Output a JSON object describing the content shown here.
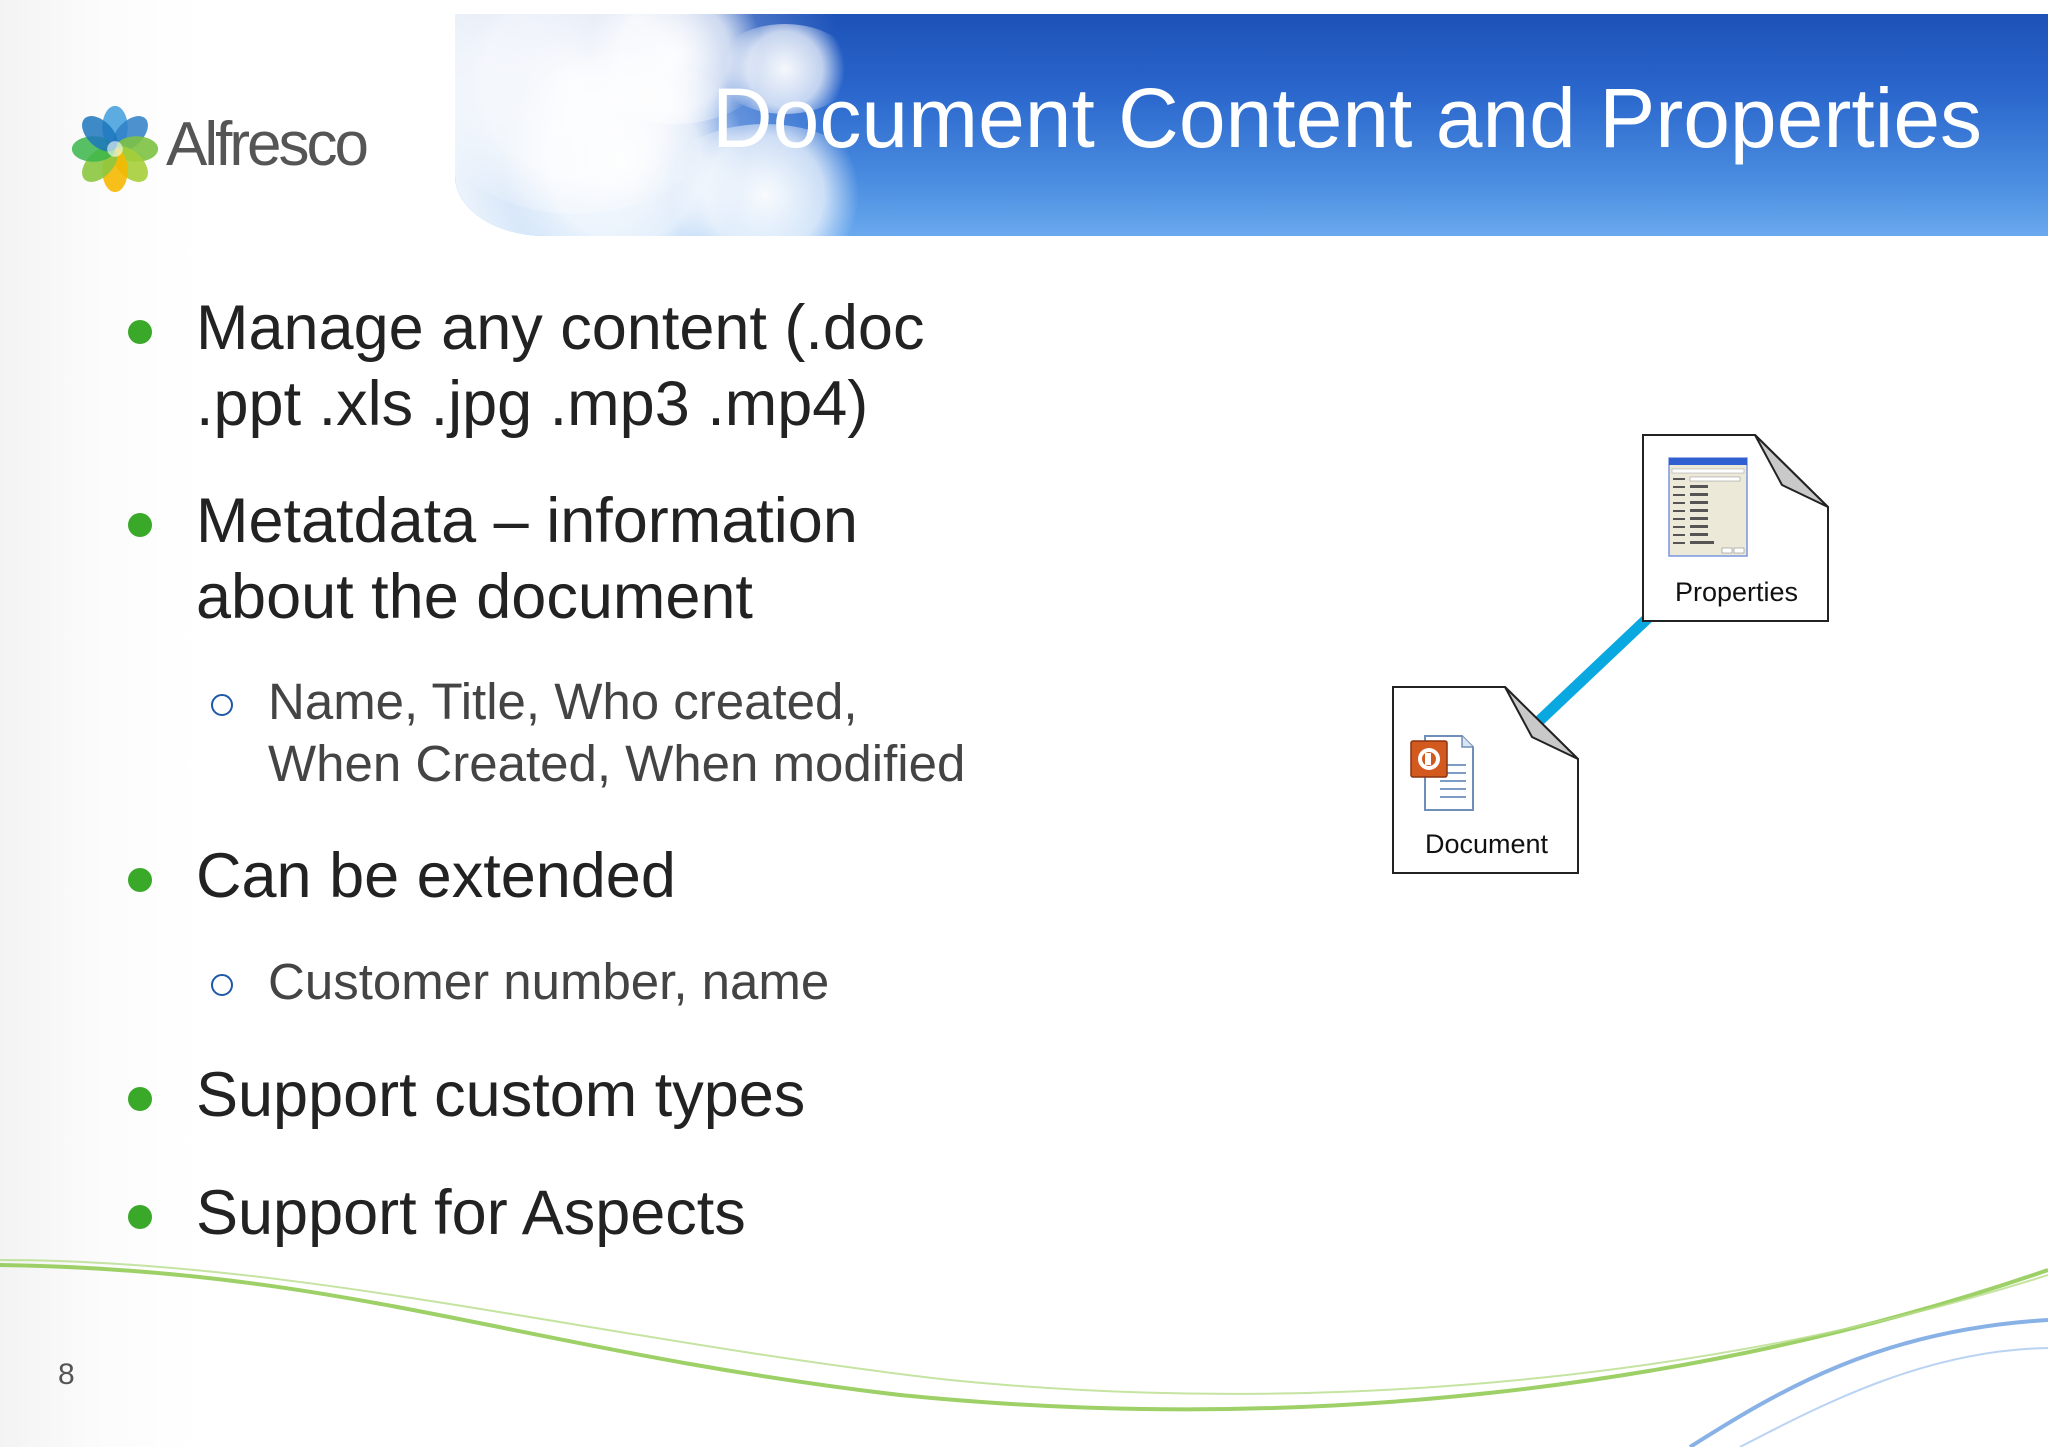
{
  "header": {
    "title": "Document Content and Properties",
    "logo_text": "Alfresco"
  },
  "content": {
    "bullets": [
      {
        "level": 1,
        "lines": [
          "Manage any content (.doc",
          ".ppt .xls .jpg .mp3 .mp4)"
        ]
      },
      {
        "level": 1,
        "lines": [
          "Metatdata – information",
          "about the document"
        ]
      },
      {
        "level": 2,
        "lines": [
          "Name, Title, Who created,",
          "When Created, When modified"
        ]
      },
      {
        "level": 1,
        "lines": [
          "Can be extended"
        ]
      },
      {
        "level": 2,
        "lines": [
          "Customer number, name"
        ]
      },
      {
        "level": 1,
        "lines": [
          "Support custom types"
        ]
      },
      {
        "level": 1,
        "lines": [
          "Support for Aspects"
        ]
      }
    ]
  },
  "diagram": {
    "properties_label": "Properties",
    "document_label": "Document",
    "properties_icon": "properties-dialog-icon",
    "document_icon": "powerpoint-file-icon",
    "connector_color": "#0aa8e0"
  },
  "footer": {
    "page_number": "8"
  },
  "colors": {
    "bullet_level1": "#3aa829",
    "bullet_level2": "#1e58a8",
    "banner": "#2a66cc"
  }
}
